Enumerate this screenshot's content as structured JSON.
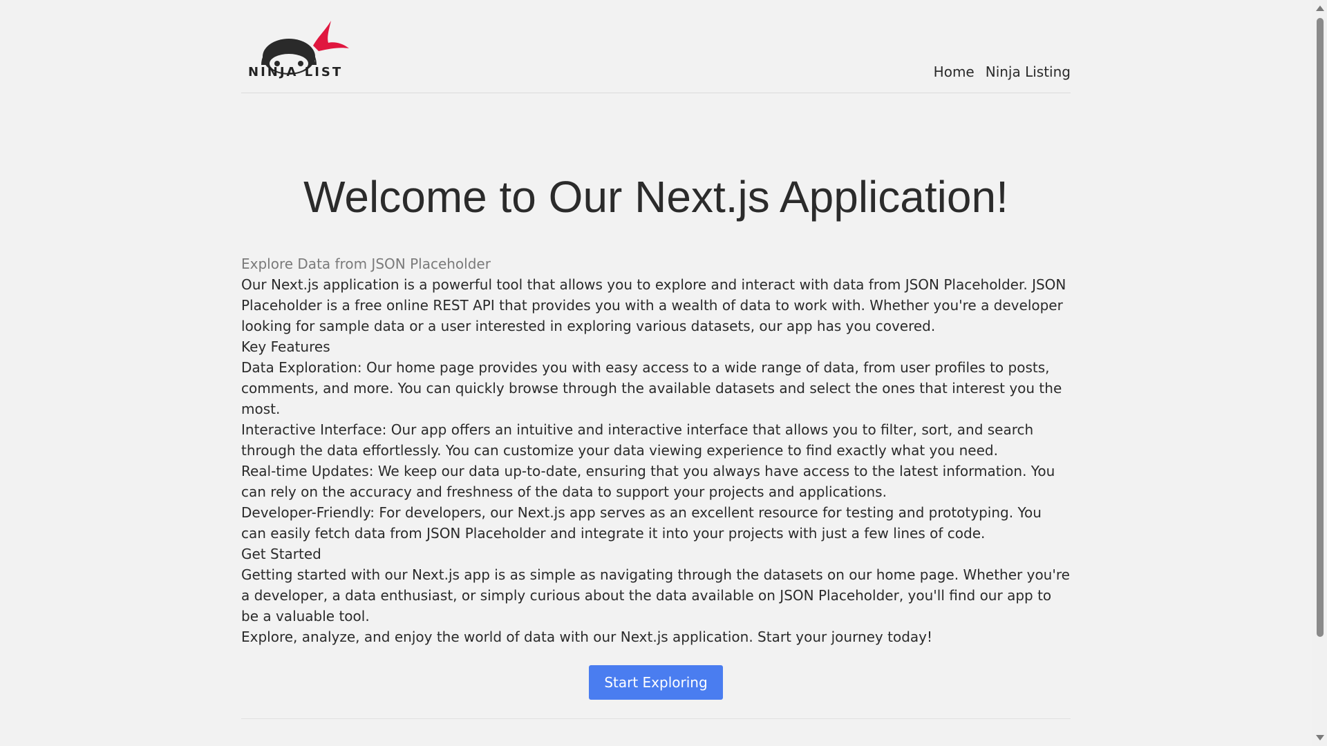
{
  "header": {
    "logo_text": "NINJA LIST",
    "nav": [
      {
        "label": "Home"
      },
      {
        "label": "Ninja Listing"
      }
    ]
  },
  "main": {
    "title": "Welcome to Our Next.js Application!",
    "subtitle": "Explore Data from JSON Placeholder",
    "paragraphs": [
      "Our Next.js application is a powerful tool that allows you to explore and interact with data from JSON Placeholder. JSON Placeholder is a free online REST API that provides you with a wealth of data to work with. Whether you're a developer looking for sample data or a user interested in exploring various datasets, our app has you covered.",
      "Key Features",
      "Data Exploration: Our home page provides you with easy access to a wide range of data, from user profiles to posts, comments, and more. You can quickly browse through the available datasets and select the ones that interest you the most.",
      "Interactive Interface: Our app offers an intuitive and interactive interface that allows you to filter, sort, and search through the data effortlessly. You can customize your data viewing experience to find exactly what you need.",
      "Real-time Updates: We keep our data up-to-date, ensuring that you always have access to the latest information. You can rely on the accuracy and freshness of the data to support your projects and applications.",
      "Developer-Friendly: For developers, our Next.js app serves as an excellent resource for testing and prototyping. You can easily fetch data from JSON Placeholder and integrate it into your projects with just a few lines of code.",
      "Get Started",
      "Getting started with our Next.js app is as simple as navigating through the datasets on our home page. Whether you're a developer, a data enthusiast, or simply curious about the data available on JSON Placeholder, you'll find our app to be a valuable tool.",
      "Explore, analyze, and enjoy the world of data with our Next.js application. Start your journey today!"
    ],
    "cta_label": "Start Exploring"
  },
  "colors": {
    "background": "#f2f2f2",
    "accent": "#4a7df0",
    "logo_red": "#e0173f",
    "text": "#2a2a2a",
    "muted": "#7a7a7a"
  },
  "icons": {
    "logo": "ninja-logo-icon",
    "scroll_up": "scroll-up-arrow-icon",
    "scroll_down": "scroll-down-arrow-icon"
  }
}
